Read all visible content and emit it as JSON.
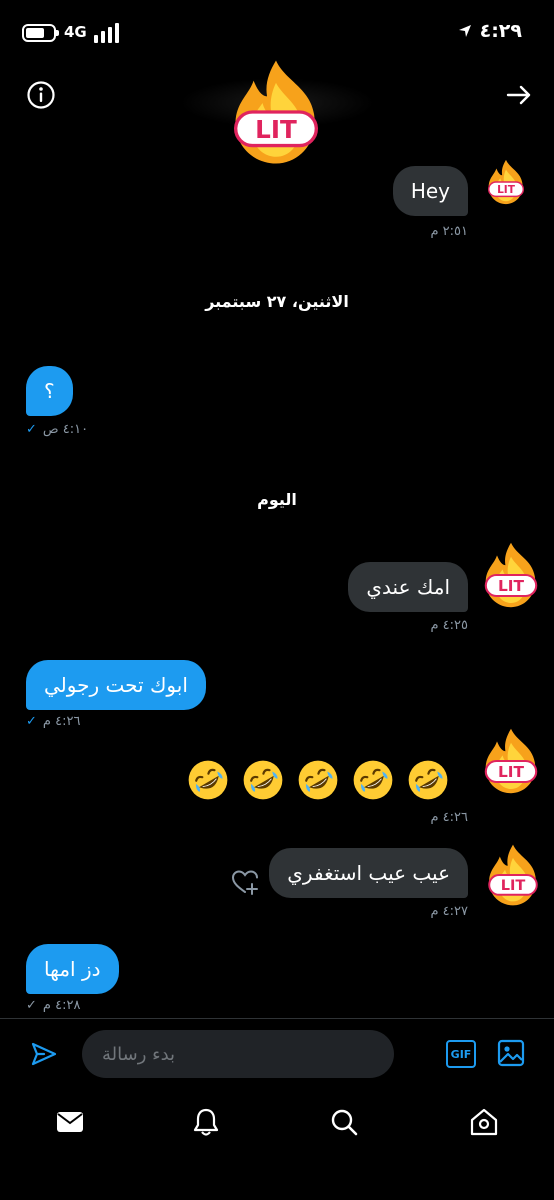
{
  "status_bar": {
    "network": "4G",
    "time": "٤:٢٩"
  },
  "header": {
    "avatar_text": "LIT"
  },
  "messages": [
    {
      "text": "Hey",
      "meta": "٢:٥١ م"
    },
    {
      "date": "الاثنين، ٢٧ سبتمبر"
    },
    {
      "text": "؟",
      "meta": "٤:١٠ ص"
    },
    {
      "date": "اليوم"
    },
    {
      "text": "امك عندي",
      "meta": "٤:٢٥ م"
    },
    {
      "text": "ابوك تحت رجولي",
      "meta": "٤:٢٦ م"
    },
    {
      "emoji": "rolling-on-floor-laughing x5",
      "meta": "٤:٢٦ م"
    },
    {
      "text": "عيب عيب استغفري",
      "meta": "٤:٢٧ م"
    },
    {
      "text": "دز امها",
      "meta": "٤:٢٨ م"
    }
  ],
  "composer": {
    "placeholder": "بدء رسالة",
    "gif_label": "GIF"
  },
  "colors": {
    "accent": "#1d9bf0",
    "incoming": "#2f3336",
    "background": "#000000"
  },
  "icons": {
    "send": "send-icon",
    "image": "image-icon",
    "mail": "mail-icon",
    "bell": "bell-icon",
    "search": "search-icon",
    "home": "home-icon",
    "info": "info-icon",
    "back": "arrow-right-icon",
    "react": "heart-plus-icon"
  }
}
